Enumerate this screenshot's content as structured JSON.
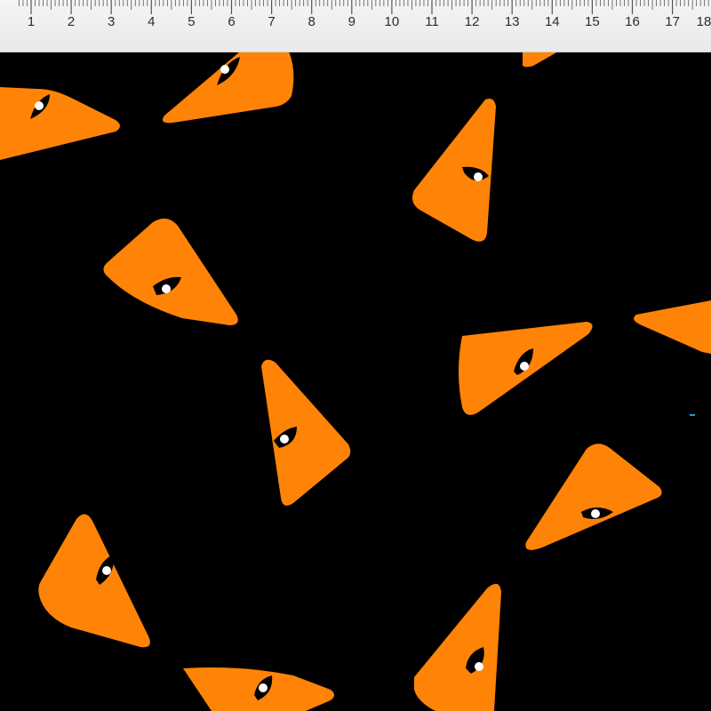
{
  "ruler": {
    "labels": [
      "1",
      "2",
      "3",
      "4",
      "5",
      "6",
      "7",
      "8",
      "9",
      "10",
      "11",
      "12",
      "13",
      "14",
      "15",
      "16",
      "17",
      "18"
    ]
  },
  "colors": {
    "background": "#000000",
    "shape": "#ff8307",
    "eye_outline": "#000000",
    "eye_pupil": "#ffffff",
    "ruler_bg": "#f2f2f2"
  },
  "pattern": {
    "motif": "orange-wedge-eye-icon"
  }
}
